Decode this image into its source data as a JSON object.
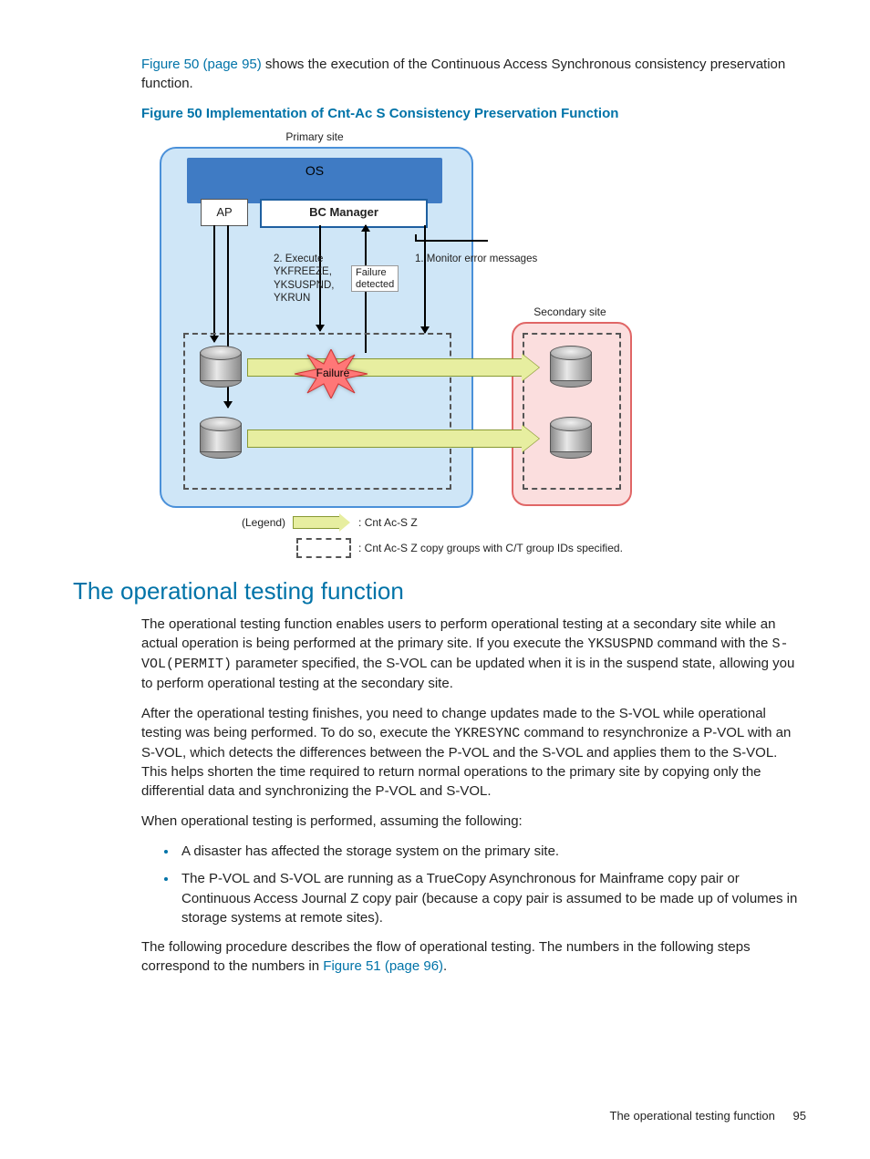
{
  "intro": {
    "link1": "Figure 50 (page 95)",
    "rest": " shows the execution of the Continuous Access Synchronous consistency preservation function."
  },
  "figure50_caption": "Figure 50 Implementation of Cnt-Ac S Consistency Preservation Function",
  "diagram": {
    "primary_site": "Primary site",
    "secondary_site": "Secondary site",
    "os": "OS",
    "ap": "AP",
    "bcm": "BC Manager",
    "step2": "2. Execute\nYKFREEZE,\nYKSUSPND,\nYKRUN",
    "fail_detected": "Failure\ndetected",
    "step1": "1. Monitor error messages",
    "failure": "Failure"
  },
  "legend": {
    "title": "(Legend)",
    "item1": ": Cnt Ac-S Z",
    "item2": ": Cnt Ac-S Z copy groups with C/T group IDs specified."
  },
  "section_heading": "The operational testing function",
  "para1": {
    "a": "The operational testing function enables users to perform operational testing at a secondary site while an actual operation is being performed at the primary site. If you execute the ",
    "code1": "YKSUSPND",
    "b": " command with the ",
    "code2": "S-VOL(PERMIT)",
    "c": " parameter specified, the S-VOL can be updated when it is in the suspend state, allowing you to perform operational testing at the secondary site."
  },
  "para2": {
    "a": "After the operational testing finishes, you need to change updates made to the S-VOL while operational testing was being performed. To do so, execute the ",
    "code1": "YKRESYNC",
    "b": " command to resynchronize a P-VOL with an S-VOL, which detects the differences between the P-VOL and the S-VOL and applies them to the S-VOL. This helps shorten the time required to return normal operations to the primary site by copying only the differential data and synchronizing the P-VOL and S-VOL."
  },
  "para3": "When operational testing is performed, assuming the following:",
  "bullets": [
    "A disaster has affected the storage system on the primary site.",
    "The P-VOL and S-VOL are running as a TrueCopy Asynchronous for Mainframe copy pair or Continuous Access Journal Z copy pair (because a copy pair is assumed to be made up of volumes in storage systems at remote sites)."
  ],
  "para4": {
    "a": "The following procedure describes the flow of operational testing. The numbers in the following steps correspond to the numbers in ",
    "link": "Figure 51 (page 96)",
    "b": "."
  },
  "footer": {
    "title": "The operational testing function",
    "page": "95"
  }
}
